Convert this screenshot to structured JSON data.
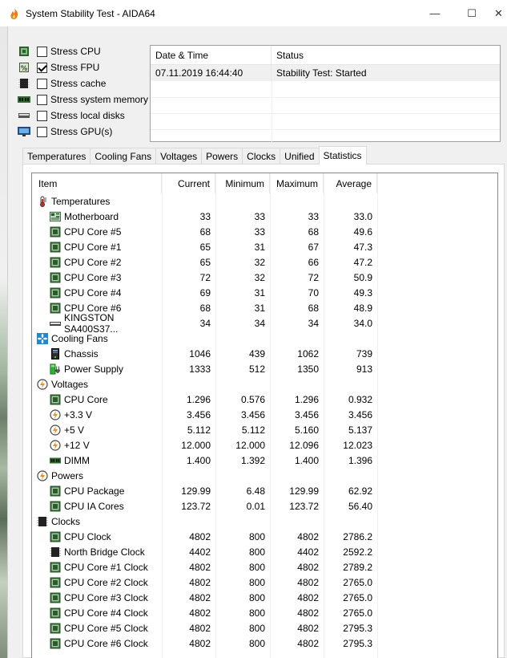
{
  "window": {
    "title": "System Stability Test - AIDA64",
    "minimize_glyph": "—",
    "maximize_glyph": "☐",
    "close_glyph": "✕"
  },
  "stress_options": [
    {
      "label": "Stress CPU",
      "checked": false,
      "icon": "cpu-icon"
    },
    {
      "label": "Stress FPU",
      "checked": true,
      "icon": "fpu-icon"
    },
    {
      "label": "Stress cache",
      "checked": false,
      "icon": "cache-icon"
    },
    {
      "label": "Stress system memory",
      "checked": false,
      "icon": "memory-icon"
    },
    {
      "label": "Stress local disks",
      "checked": false,
      "icon": "disk-icon"
    },
    {
      "label": "Stress GPU(s)",
      "checked": false,
      "icon": "gpu-icon"
    }
  ],
  "status_table": {
    "headers": [
      "Date & Time",
      "Status"
    ],
    "rows": [
      {
        "datetime": "07.11.2019 16:44:40",
        "status": "Stability Test: Started"
      }
    ]
  },
  "tabs": [
    {
      "label": "Temperatures",
      "active": false
    },
    {
      "label": "Cooling Fans",
      "active": false
    },
    {
      "label": "Voltages",
      "active": false
    },
    {
      "label": "Powers",
      "active": false
    },
    {
      "label": "Clocks",
      "active": false
    },
    {
      "label": "Unified",
      "active": false
    },
    {
      "label": "Statistics",
      "active": true
    }
  ],
  "stats": {
    "headers": {
      "item": "Item",
      "current": "Current",
      "minimum": "Minimum",
      "maximum": "Maximum",
      "average": "Average"
    },
    "rows": [
      {
        "type": "category",
        "label": "Temperatures",
        "icon": "thermometer-icon"
      },
      {
        "type": "item",
        "label": "Motherboard",
        "icon": "motherboard-icon",
        "current": "33",
        "minimum": "33",
        "maximum": "33",
        "average": "33.0"
      },
      {
        "type": "item",
        "label": "CPU Core #5",
        "icon": "chip-icon",
        "current": "68",
        "minimum": "33",
        "maximum": "68",
        "average": "49.6"
      },
      {
        "type": "item",
        "label": "CPU Core #1",
        "icon": "chip-icon",
        "current": "65",
        "minimum": "31",
        "maximum": "67",
        "average": "47.3"
      },
      {
        "type": "item",
        "label": "CPU Core #2",
        "icon": "chip-icon",
        "current": "65",
        "minimum": "32",
        "maximum": "66",
        "average": "47.2"
      },
      {
        "type": "item",
        "label": "CPU Core #3",
        "icon": "chip-icon",
        "current": "72",
        "minimum": "32",
        "maximum": "72",
        "average": "50.9"
      },
      {
        "type": "item",
        "label": "CPU Core #4",
        "icon": "chip-icon",
        "current": "69",
        "minimum": "31",
        "maximum": "70",
        "average": "49.3"
      },
      {
        "type": "item",
        "label": "CPU Core #6",
        "icon": "chip-icon",
        "current": "68",
        "minimum": "31",
        "maximum": "68",
        "average": "48.9"
      },
      {
        "type": "item",
        "label": "KINGSTON SA400S37...",
        "icon": "drive-icon",
        "current": "34",
        "minimum": "34",
        "maximum": "34",
        "average": "34.0"
      },
      {
        "type": "category",
        "label": "Cooling Fans",
        "icon": "fan-icon"
      },
      {
        "type": "item",
        "label": "Chassis",
        "icon": "chassis-icon",
        "current": "1046",
        "minimum": "439",
        "maximum": "1062",
        "average": "739"
      },
      {
        "type": "item",
        "label": "Power Supply",
        "icon": "power-supply-icon",
        "current": "1333",
        "minimum": "512",
        "maximum": "1350",
        "average": "913"
      },
      {
        "type": "category",
        "label": "Voltages",
        "icon": "voltage-icon"
      },
      {
        "type": "item",
        "label": "CPU Core",
        "icon": "chip-icon",
        "current": "1.296",
        "minimum": "0.576",
        "maximum": "1.296",
        "average": "0.932"
      },
      {
        "type": "item",
        "label": "+3.3 V",
        "icon": "voltage-icon",
        "current": "3.456",
        "minimum": "3.456",
        "maximum": "3.456",
        "average": "3.456"
      },
      {
        "type": "item",
        "label": "+5 V",
        "icon": "voltage-icon",
        "current": "5.112",
        "minimum": "5.112",
        "maximum": "5.160",
        "average": "5.137"
      },
      {
        "type": "item",
        "label": "+12 V",
        "icon": "voltage-icon",
        "current": "12.000",
        "minimum": "12.000",
        "maximum": "12.096",
        "average": "12.023"
      },
      {
        "type": "item",
        "label": "DIMM",
        "icon": "dimm-icon",
        "current": "1.400",
        "minimum": "1.392",
        "maximum": "1.400",
        "average": "1.396"
      },
      {
        "type": "category",
        "label": "Powers",
        "icon": "voltage-icon"
      },
      {
        "type": "item",
        "label": "CPU Package",
        "icon": "chip-icon",
        "current": "129.99",
        "minimum": "6.48",
        "maximum": "129.99",
        "average": "62.92"
      },
      {
        "type": "item",
        "label": "CPU IA Cores",
        "icon": "chip-icon",
        "current": "123.72",
        "minimum": "0.01",
        "maximum": "123.72",
        "average": "56.40"
      },
      {
        "type": "category",
        "label": "Clocks",
        "icon": "clock-chip-icon"
      },
      {
        "type": "item",
        "label": "CPU Clock",
        "icon": "chip-icon",
        "current": "4802",
        "minimum": "800",
        "maximum": "4802",
        "average": "2786.2"
      },
      {
        "type": "item",
        "label": "North Bridge Clock",
        "icon": "clock-chip-icon",
        "current": "4402",
        "minimum": "800",
        "maximum": "4402",
        "average": "2592.2"
      },
      {
        "type": "item",
        "label": "CPU Core #1 Clock",
        "icon": "chip-icon",
        "current": "4802",
        "minimum": "800",
        "maximum": "4802",
        "average": "2789.2"
      },
      {
        "type": "item",
        "label": "CPU Core #2 Clock",
        "icon": "chip-icon",
        "current": "4802",
        "minimum": "800",
        "maximum": "4802",
        "average": "2765.0"
      },
      {
        "type": "item",
        "label": "CPU Core #3 Clock",
        "icon": "chip-icon",
        "current": "4802",
        "minimum": "800",
        "maximum": "4802",
        "average": "2765.0"
      },
      {
        "type": "item",
        "label": "CPU Core #4 Clock",
        "icon": "chip-icon",
        "current": "4802",
        "minimum": "800",
        "maximum": "4802",
        "average": "2765.0"
      },
      {
        "type": "item",
        "label": "CPU Core #5 Clock",
        "icon": "chip-icon",
        "current": "4802",
        "minimum": "800",
        "maximum": "4802",
        "average": "2795.3"
      },
      {
        "type": "item",
        "label": "CPU Core #6 Clock",
        "icon": "chip-icon",
        "current": "4802",
        "minimum": "800",
        "maximum": "4802",
        "average": "2795.3"
      }
    ]
  }
}
